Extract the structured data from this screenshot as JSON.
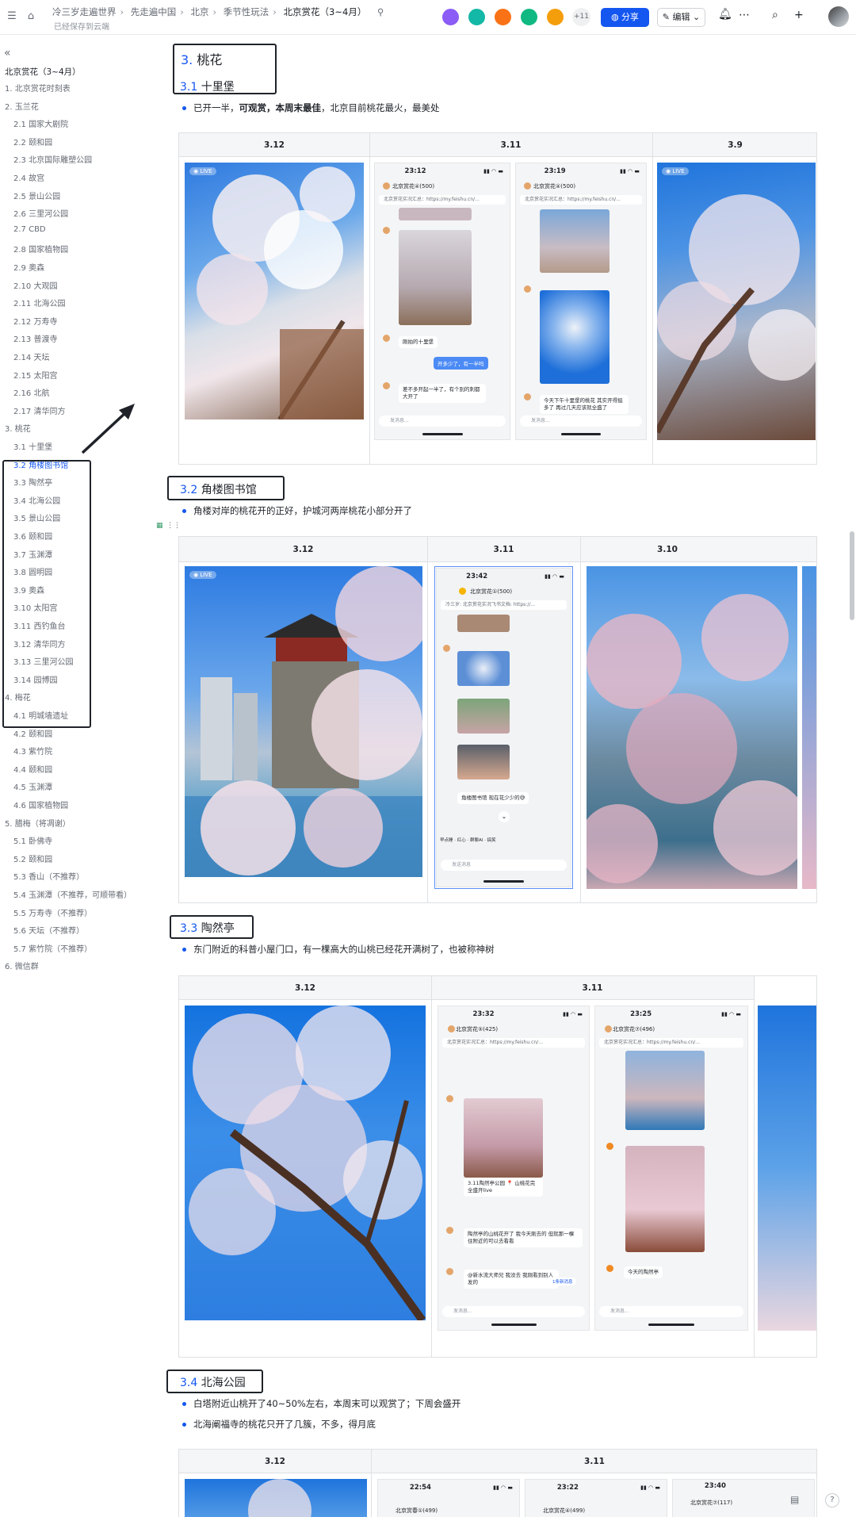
{
  "topbar": {
    "breadcrumbs": [
      "冷三岁走遍世界",
      "先走遍中国",
      "北京",
      "季节性玩法",
      "北京赏花（3~4月）"
    ],
    "saved_status": "已经保存到云端",
    "extra_members": "+11",
    "share_label": "分享",
    "edit_label": "编辑",
    "avatar_colors": [
      "#8b5cf6",
      "#14b8a6",
      "#f97316",
      "#10b981",
      "#f59e0b"
    ]
  },
  "sidebar": {
    "title": "北京赏花（3~4月）",
    "items": [
      "1. 北京赏花时刻表",
      "2. 玉兰花",
      "2.1 国家大剧院",
      "2.2 颐和园",
      "2.3 北京国际雕塑公园",
      "2.4 故宫",
      "2.5 景山公园",
      "2.6 三里河公园",
      "2.7 CBD",
      "2.8 国家植物园",
      "2.9 奥森",
      "2.10 大观园",
      "2.11 北海公园",
      "2.12 万寿寺",
      "2.13 普渡寺",
      "2.14 天坛",
      "2.15 太阳宫",
      "2.16 北航",
      "2.17 清华同方",
      "3. 桃花",
      "3.1 十里堡",
      "3.2 角楼图书馆",
      "3.3 陶然亭",
      "3.4 北海公园",
      "3.5 景山公园",
      "3.6 颐和园",
      "3.7 玉渊潭",
      "3.8 圆明园",
      "3.9 奥森",
      "3.10 太阳宫",
      "3.11 西钓鱼台",
      "3.12 清华同方",
      "3.13 三里河公园",
      "3.14 园博园",
      "4. 梅花",
      "4.1 明城墙遗址",
      "4.2 颐和园",
      "4.3 紫竹院",
      "4.4 颐和园",
      "4.5 玉渊潭",
      "4.6 国家植物园",
      "5. 腊梅（将凋谢）",
      "5.1 卧佛寺",
      "5.2 颐和园",
      "5.3 香山（不推荐）",
      "5.4 玉渊潭（不推荐，可顺带看）",
      "5.5 万寿寺（不推荐）",
      "5.6 天坛（不推荐）",
      "5.7 紫竹院（不推荐）",
      "6. 微信群"
    ]
  },
  "content": {
    "s3": {
      "num": "3.",
      "title": "桃花"
    },
    "s31": {
      "num": "3.1",
      "title": "十里堡",
      "bullet_a": "已开一半，",
      "bullet_b": "可观赏，本周末最佳",
      "bullet_c": "，北京目前桃花最火，最美处",
      "cols": [
        "3.12",
        "3.11",
        "3.9"
      ]
    },
    "s32": {
      "num": "3.2",
      "title": "角楼图书馆",
      "bullet": "角楼对岸的桃花开的正好，护城河两岸桃花小部分开了",
      "cols": [
        "3.12",
        "3.11",
        "3.10"
      ]
    },
    "s33": {
      "num": "3.3",
      "title": "陶然亭",
      "bullet": "东门附近的科普小屋门口，有一棵高大的山桃已经花开满树了，也被称神树",
      "cols": [
        "3.12",
        "3.11"
      ]
    },
    "s34": {
      "num": "3.4",
      "title": "北海公园",
      "bullet1": "白塔附近山桃开了40~50%左右，本周末可以观赏了；下周会盛开",
      "bullet2": "北海阐福寺的桃花只开了几簇，不多，得月底",
      "cols": [
        "3.12",
        "3.11"
      ]
    }
  },
  "phones": {
    "p1": {
      "time": "23:12",
      "name": "北京赏花④(500)",
      "pin": "北京赏花实况汇总：https://my.feishu.cn/...",
      "msg1": "刚拍的十里堡",
      "mine": "开多少了，有一半吗",
      "msg2": "差不多开起一半了，有个别的刺都大开了",
      "input": "发消息..."
    },
    "p2": {
      "time": "23:19",
      "name": "北京赏花④(500)",
      "pin": "北京赏花实况汇总：https://my.feishu.cn/...",
      "msg1": "今天下午十里堡的桃花 其实开得挺多了 再过几天应该就全盛了",
      "input": "发消息..."
    },
    "p3": {
      "time": "23:42",
      "name": "北京赏花①(500)",
      "pin": "冷三岁: 北京赏花实况飞书文档: https://...",
      "msg1": "角楼图书馆 现在花少少的😅",
      "input": "发送消息",
      "tools": [
        "早点睡",
        "红心",
        "群聊AI",
        "搞笑"
      ]
    },
    "p4": {
      "time": "23:32",
      "name": "北京赏花⑤(425)",
      "pin": "北京赏花实况汇总：https://my.feishu.cn/...",
      "card": "3.11陶然亭公园 📍 山桃花完全盛开live",
      "msg1": "陶然亭的山桃花开了 我今天刚去的 但就那一棵 住附近的可以去看看",
      "msg2": "@新水流大师兄 我没去 我刚看到别人发的",
      "new": "1条新消息",
      "input": "发消息..."
    },
    "p5": {
      "time": "23:25",
      "name": "北京赏花⑦(496)",
      "pin": "北京赏花实况汇总：https://my.feishu.cn/...",
      "msg1": "今天的陶然亭",
      "input": "发消息..."
    },
    "p6": {
      "time": "22:54",
      "name": "北京赏春①(499)"
    },
    "p7": {
      "time": "23:22",
      "name": "北京赏花④(499)"
    },
    "p8": {
      "time": "23:40",
      "name": "北京赏花⑦(117)"
    }
  },
  "icons": [
    "sidebar-toggle-icon",
    "home-icon",
    "pin-icon",
    "globe-icon",
    "edit-icon",
    "chevron-down-icon",
    "more-icon",
    "bell-icon",
    "search-icon",
    "plus-icon",
    "collapse-icon",
    "help-icon"
  ]
}
